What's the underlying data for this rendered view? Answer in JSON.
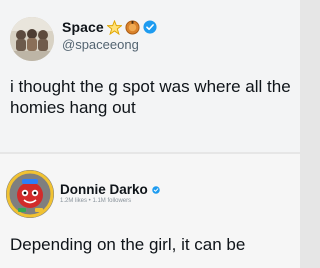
{
  "tweet1": {
    "display_name": "Space",
    "handle": "@spaceeong",
    "text": "i thought the g spot was where all the homies hang out",
    "badges": [
      "star-icon",
      "coin-icon",
      "verified-badge-icon"
    ]
  },
  "tweet2": {
    "display_name": "Donnie Darko",
    "stats": "1.2M likes • 1.1M followers",
    "text": "Depending on the girl, it can be",
    "badges": [
      "verified-badge-icon"
    ]
  },
  "colors": {
    "verified_blue": "#1d9bf0",
    "secondary_text": "#536471",
    "primary_text": "#0f1419"
  }
}
